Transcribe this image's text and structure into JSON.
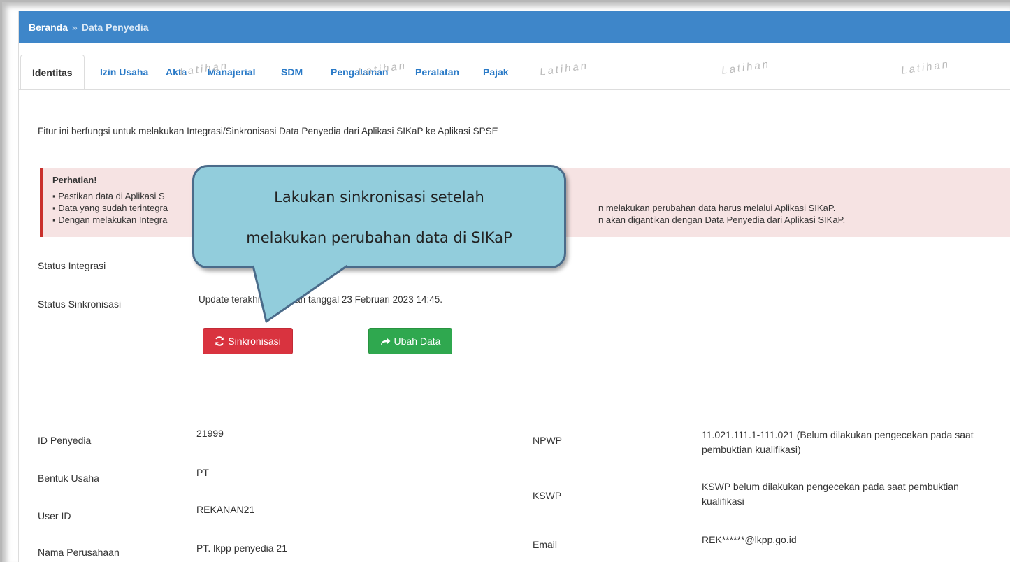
{
  "breadcrumb": {
    "home": "Beranda",
    "separator": "»",
    "current": "Data Penyedia"
  },
  "tabs": [
    {
      "label": "Identitas",
      "active": true
    },
    {
      "label": "Izin Usaha"
    },
    {
      "label": "Akta"
    },
    {
      "label": "Manajerial"
    },
    {
      "label": "SDM"
    },
    {
      "label": "Pengalaman"
    },
    {
      "label": "Peralatan"
    },
    {
      "label": "Pajak"
    }
  ],
  "watermark": "Latihan",
  "intro_text": "Fitur ini berfungsi untuk melakukan Integrasi/Sinkronisasi Data Penyedia dari Aplikasi SIKaP ke Aplikasi SPSE",
  "alert": {
    "title": "Perhatian!",
    "line1_start": "▪  Pastikan data di Aplikasi S",
    "line2_start": "▪  Data yang sudah terintegra",
    "line2_end": "n melakukan perubahan data harus melalui Aplikasi SIKaP.",
    "line3_start": "▪  Dengan melakukan Integra",
    "line3_end": "n akan digantikan dengan Data Penyedia dari Aplikasi SIKaP."
  },
  "callout": {
    "line1": "Lakukan sinkronisasi setelah",
    "line2": "melakukan perubahan data di SIKaP"
  },
  "status": {
    "integrasi_label": "Status Integrasi",
    "sinkronisasi_label": "Status Sinkronisasi",
    "sinkronisasi_value": "Update terakhir dilakukan tanggal 23 Februari 2023 14:45."
  },
  "buttons": {
    "sinkronisasi": "Sinkronisasi",
    "ubah_data": "Ubah Data"
  },
  "identity": {
    "id_penyedia_label": "ID Penyedia",
    "id_penyedia_value": "21999",
    "bentuk_usaha_label": "Bentuk Usaha",
    "bentuk_usaha_value": "PT",
    "user_id_label": "User ID",
    "user_id_value": "REKANAN21",
    "nama_perusahaan_label": "Nama Perusahaan",
    "nama_perusahaan_value": "PT. lkpp penyedia 21",
    "npwp_label": "NPWP",
    "npwp_value_line1": "11.021.111.1-111.021 (Belum dilakukan pengecekan pada saat",
    "npwp_value_line2": "pembuktian kualifikasi)",
    "kswp_label": "KSWP",
    "kswp_value_line1": "KSWP belum dilakukan pengecekan pada saat pembuktian",
    "kswp_value_line2": "kualifikasi",
    "email_label": "Email",
    "email_value": "REK******@lkpp.go.id"
  },
  "icons": {
    "sync": "sync-icon",
    "share": "share-arrow-icon"
  },
  "colors": {
    "header": "#3e86c9",
    "danger": "#d9333f",
    "success": "#2fa84f",
    "callout": "#92cddc"
  }
}
